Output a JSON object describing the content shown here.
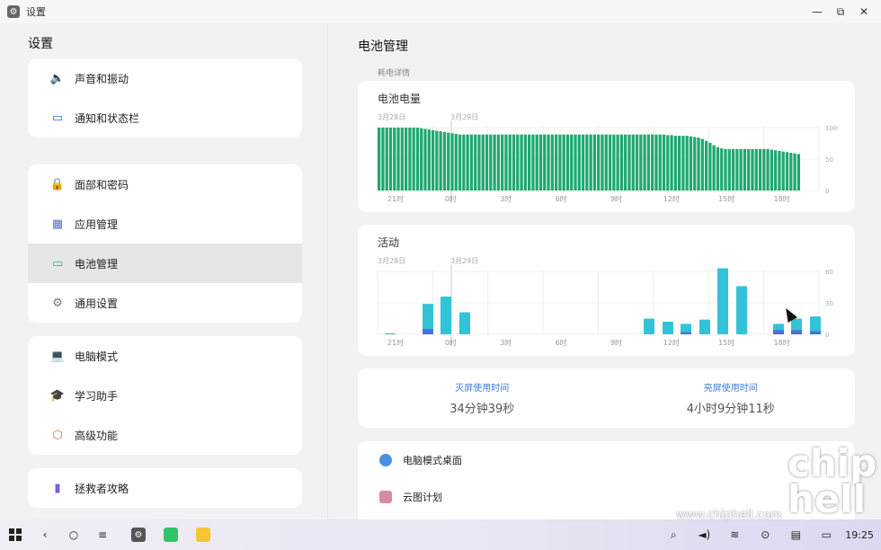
{
  "window": {
    "title": "设置",
    "icon": "gear-icon"
  },
  "sidebar": {
    "title": "设置",
    "groups": [
      [
        {
          "label": "声音和振动",
          "icon": "speaker-icon",
          "color": "#e0474c"
        },
        {
          "label": "通知和状态栏",
          "icon": "notification-icon",
          "color": "#3a6fd8"
        }
      ],
      [
        {
          "label": "面部和密码",
          "icon": "lock-icon",
          "color": "#e0474c"
        },
        {
          "label": "应用管理",
          "icon": "apps-grid-icon",
          "color": "#5b6fd6"
        },
        {
          "label": "电池管理",
          "icon": "battery-icon",
          "color": "#1fb87a",
          "active": true
        },
        {
          "label": "通用设置",
          "icon": "gear-icon",
          "color": "#777777"
        }
      ],
      [
        {
          "label": "电脑模式",
          "icon": "laptop-icon",
          "color": "#3a6fd8"
        },
        {
          "label": "学习助手",
          "icon": "graduation-cap-icon",
          "color": "#f59a2b"
        },
        {
          "label": "高级功能",
          "icon": "advanced-features-icon",
          "color": "#f26b3a"
        }
      ],
      [
        {
          "label": "拯救者攻略",
          "icon": "guide-book-icon",
          "color": "#7a5cd6"
        }
      ]
    ]
  },
  "main": {
    "title": "电池管理",
    "section_label": "耗电详情",
    "usage": {
      "screen_off_label": "灭屏使用时间",
      "screen_off_value": "34分钟39秒",
      "screen_on_label": "亮屏使用时间",
      "screen_on_value": "4小时9分钟11秒"
    },
    "apps": [
      {
        "name": "电脑模式桌面",
        "icon": "desktop-mode-icon",
        "color": "#4a8fe0"
      },
      {
        "name": "云图计划",
        "icon": "cloud-plan-icon",
        "color": "#d98aa8"
      }
    ]
  },
  "chart_data": [
    {
      "type": "bar",
      "title": "电池电量",
      "date_labels": [
        "3月28日",
        "3月29日"
      ],
      "x_ticks": [
        "21时",
        "0时",
        "3时",
        "6时",
        "9时",
        "12时",
        "15时",
        "18时"
      ],
      "y_ticks": [
        "100",
        "50",
        "0"
      ],
      "ylim": [
        0,
        100
      ],
      "color": "#1fa870",
      "values": [
        100,
        100,
        100,
        100,
        100,
        100,
        100,
        100,
        100,
        100,
        100,
        99,
        98,
        97,
        96,
        95,
        94,
        93,
        92,
        91,
        90,
        89,
        89,
        89,
        89,
        89,
        89,
        89,
        89,
        89,
        89,
        89,
        89,
        89,
        89,
        89,
        89,
        89,
        89,
        89,
        89,
        89,
        89,
        89,
        89,
        89,
        89,
        89,
        89,
        89,
        89,
        89,
        89,
        89,
        89,
        89,
        89,
        89,
        89,
        89,
        89,
        89,
        89,
        89,
        89,
        89,
        89,
        89,
        89,
        89,
        89,
        89,
        89,
        89,
        89,
        88,
        88,
        87,
        87,
        87,
        87,
        86,
        85,
        84,
        82,
        79,
        76,
        72,
        69,
        67,
        66,
        66,
        66,
        66,
        66,
        66,
        66,
        66,
        66,
        66,
        66,
        66,
        65,
        64,
        63,
        62,
        61,
        60,
        59,
        58
      ]
    },
    {
      "type": "bar",
      "title": "活动",
      "date_labels": [
        "3月28日",
        "3月29日"
      ],
      "x_ticks": [
        "21时",
        "0时",
        "3时",
        "6时",
        "9时",
        "12时",
        "15时",
        "18时"
      ],
      "y_ticks": [
        "60",
        "30",
        "0"
      ],
      "ylim": [
        0,
        60
      ],
      "colors": {
        "screen_on": "#33c3d6",
        "screen_off": "#4a6fe0"
      },
      "categories": [
        "20:00",
        "21:00",
        "22:00",
        "23:00",
        "0:00",
        "9:00",
        "10:00",
        "11:00",
        "12:00",
        "13:00",
        "14:00",
        "15:00",
        "16:00",
        "17:00",
        "18:00",
        "19:00"
      ],
      "screen_on": [
        1,
        0,
        29,
        36,
        21,
        15,
        12,
        10,
        14,
        63,
        46,
        0,
        10,
        15,
        17,
        0
      ],
      "screen_off": [
        0,
        0,
        5,
        0,
        0,
        0,
        0,
        2,
        0,
        0,
        0,
        0,
        4,
        4,
        3,
        0
      ]
    }
  ],
  "taskbar": {
    "left": [
      {
        "icon": "start-grid-icon"
      },
      {
        "icon": "back-icon",
        "glyph": "‹"
      },
      {
        "icon": "home-icon",
        "glyph": "○"
      },
      {
        "icon": "menu-icon",
        "glyph": "≡"
      }
    ],
    "apps": [
      {
        "icon": "settings-app-icon",
        "color": "#555555"
      },
      {
        "icon": "green-app-icon",
        "color": "#2ec56a"
      },
      {
        "icon": "notes-app-icon",
        "color": "#f5c633"
      }
    ],
    "right": [
      {
        "icon": "search-icon",
        "glyph": "⌕"
      },
      {
        "icon": "volume-icon",
        "glyph": "◄)"
      },
      {
        "icon": "wifi-icon",
        "glyph": "≋"
      },
      {
        "icon": "navigation-icon",
        "glyph": "⊙"
      },
      {
        "icon": "notes-icon",
        "glyph": "▤"
      },
      {
        "icon": "battery-status-icon",
        "glyph": "▭"
      }
    ],
    "clock": "19:25"
  },
  "watermark": {
    "url": "www.chiphell.com",
    "logo": "chip hell"
  }
}
